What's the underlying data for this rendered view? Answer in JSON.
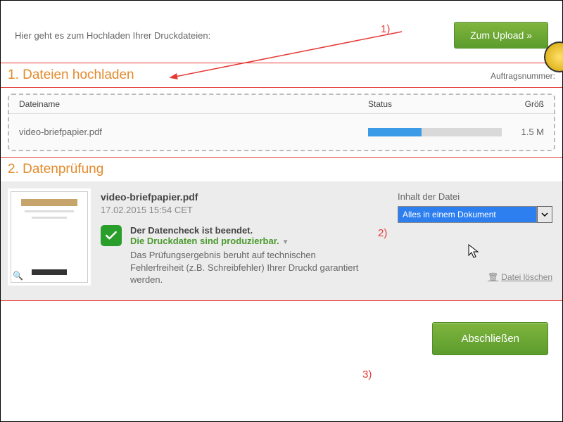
{
  "top": {
    "hint_text": "Hier geht es zum Hochladen Ihrer Druckdateien:",
    "upload_button": "Zum Upload »"
  },
  "section1": {
    "title": "1. Dateien hochladen",
    "order_label": "Auftragsnummer:",
    "columns": {
      "name": "Dateiname",
      "status": "Status",
      "size": "Größ"
    },
    "file": {
      "name": "video-briefpapier.pdf",
      "size": "1.5 M",
      "progress_pct": 40
    }
  },
  "section2": {
    "title": "2. Datenprüfung",
    "file_name": "video-briefpapier.pdf",
    "file_date": "17.02.2015 15:54 CET",
    "check_done": "Der Datencheck ist beendet.",
    "producible": "Die Druckdaten sind produzierbar.",
    "detail": "Das Prüfungsergebnis beruht auf technischen Fehlerfreiheit (z.B. Schreibfehler) Ihrer Druckd garantiert werden.",
    "content_label": "Inhalt der Datei",
    "select_value": "Alles in einem Dokument",
    "delete_label": "Datei löschen"
  },
  "footer": {
    "finish_button": "Abschließen"
  },
  "annotations": {
    "a1": "1)",
    "a2": "2)",
    "a3": "3)"
  }
}
